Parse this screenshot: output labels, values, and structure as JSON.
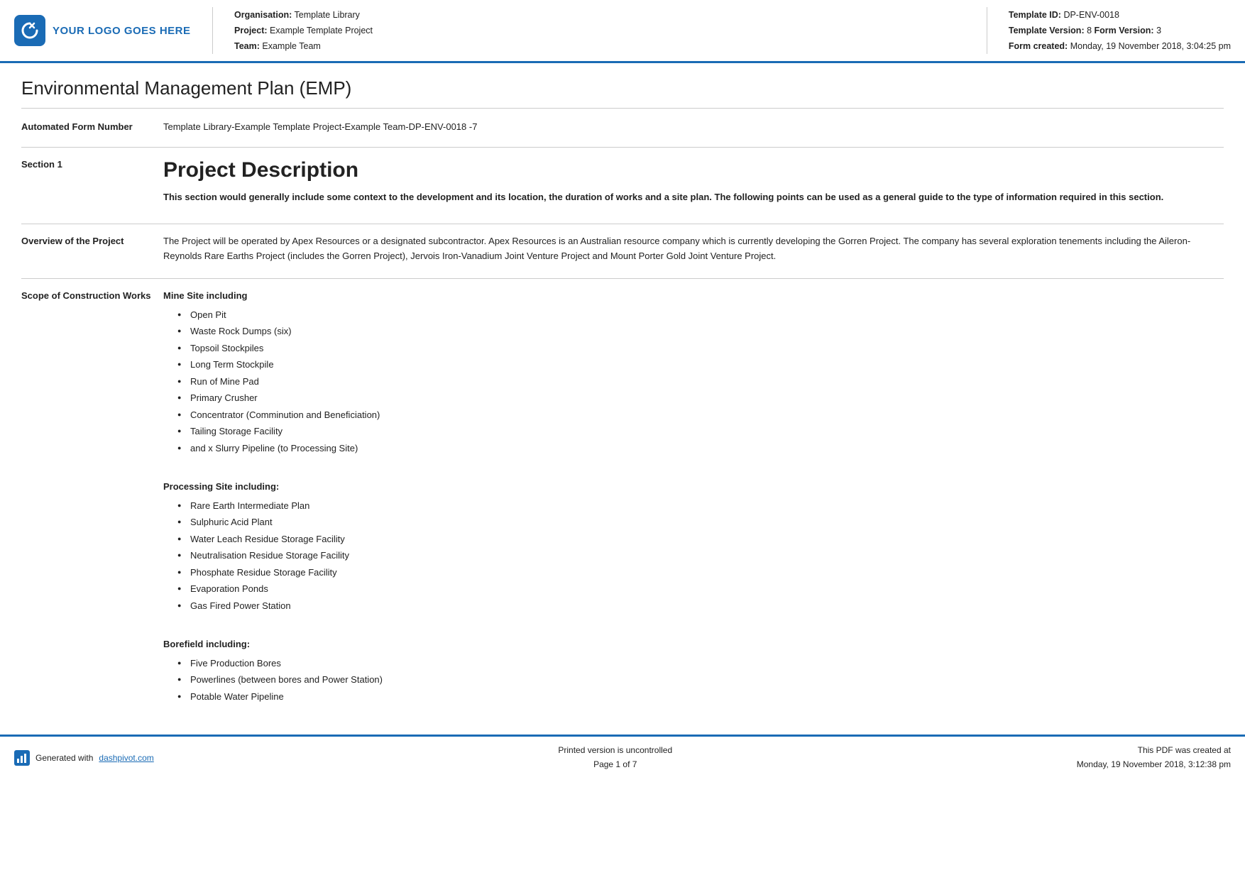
{
  "header": {
    "logo_text": "YOUR LOGO GOES HERE",
    "org_label": "Organisation:",
    "org_value": "Template Library",
    "project_label": "Project:",
    "project_value": "Example Template Project",
    "team_label": "Team:",
    "team_value": "Example Team",
    "template_id_label": "Template ID:",
    "template_id_value": "DP-ENV-0018",
    "template_version_label": "Template Version:",
    "template_version_value": "8",
    "form_version_label": "Form Version:",
    "form_version_value": "3",
    "form_created_label": "Form created:",
    "form_created_value": "Monday, 19 November 2018, 3:04:25 pm"
  },
  "doc": {
    "title": "Environmental Management Plan (EMP)",
    "automated_form_label": "Automated Form Number",
    "automated_form_value": "Template Library-Example Template Project-Example Team-DP-ENV-0018   -7",
    "section1_label": "Section 1",
    "section1_heading": "Project Description",
    "section1_intro": "This section would generally include some context to the development and its location, the duration of works and a site plan. The following points can be used as a general guide to the type of information required in this section.",
    "overview_label": "Overview of the Project",
    "overview_text": "The Project will be operated by Apex Resources or a designated subcontractor. Apex Resources is an Australian resource company which is currently developing the Gorren Project. The company has several exploration tenements including the Aileron-Reynolds Rare Earths Project (includes the Gorren Project), Jervois Iron-Vanadium Joint Venture Project and Mount Porter Gold Joint Venture Project.",
    "scope_label": "Scope of Construction Works",
    "mine_site_heading": "Mine Site including",
    "mine_site_items": [
      "Open Pit",
      "Waste Rock Dumps (six)",
      "Topsoil Stockpiles",
      "Long Term Stockpile",
      "Run of Mine Pad",
      "Primary Crusher",
      "Concentrator (Comminution and Beneficiation)",
      "Tailing Storage Facility",
      "and x Slurry Pipeline (to Processing Site)"
    ],
    "processing_site_heading": "Processing Site including:",
    "processing_site_items": [
      "Rare Earth Intermediate Plan",
      "Sulphuric Acid Plant",
      "Water Leach Residue Storage Facility",
      "Neutralisation Residue Storage Facility",
      "Phosphate Residue Storage Facility",
      "Evaporation Ponds",
      "Gas Fired Power Station"
    ],
    "borefield_heading": "Borefield including:",
    "borefield_items": [
      "Five Production Bores",
      "Powerlines (between bores and Power Station)",
      "Potable Water Pipeline"
    ]
  },
  "footer": {
    "generated_text": "Generated with",
    "generated_link": "dashpivot.com",
    "center_line1": "Printed version is uncontrolled",
    "center_line2": "Page 1 of 7",
    "right_line1": "This PDF was created at",
    "right_line2": "Monday, 19 November 2018, 3:12:38 pm"
  }
}
